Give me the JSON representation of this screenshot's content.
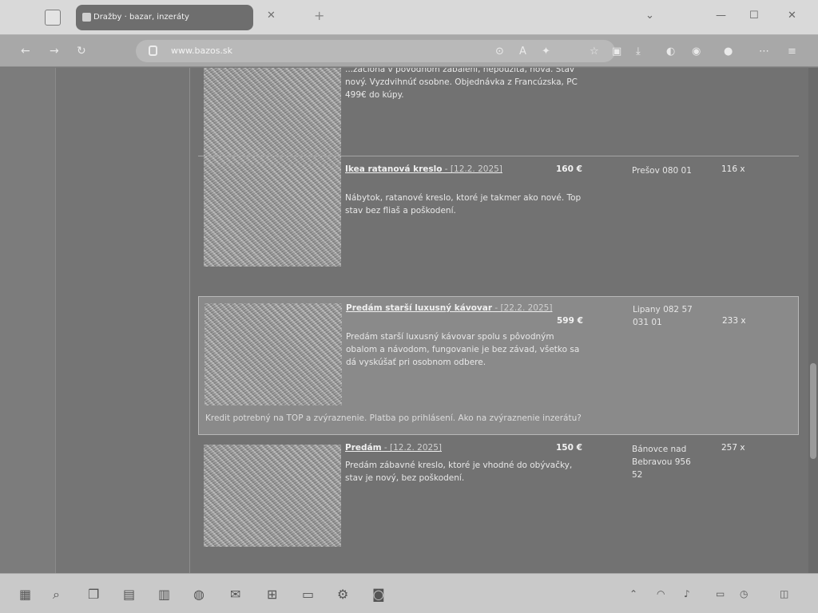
{
  "browser": {
    "tab_title": "Dražby · bazar, inzeráty",
    "close_tab": "✕",
    "new_tab": "+",
    "url": "www.bazos.sk",
    "window_controls": {
      "tabs_list": "⌄",
      "minimize": "—",
      "maximize": "☐",
      "close": "✕"
    }
  },
  "listings": [
    {
      "title": "",
      "date": "",
      "price": "",
      "location": "",
      "views": "",
      "description": "...záclona v pôvodnom zabalení, nepoužitá, nová. Stav nový. Vyzdvihnúť osobne. Objednávka z Francúzska, PC 499€ do kúpy.",
      "note": ""
    },
    {
      "title": "Ikea ratanová kreslo",
      "date": " - [12.2. 2025]",
      "price": "160 €",
      "location": "Prešov 080 01",
      "views": "116 x",
      "description": "Nábytok, ratanové kreslo, ktoré je takmer ako nové. Top stav bez fliaš a poškodení.",
      "note": ""
    },
    {
      "title": "Predám starší luxusný kávovar",
      "date": " - [22.2. 2025]",
      "price": "599 €",
      "location": "Lipany 082 57 031 01",
      "views": "233 x",
      "description": "Predám starší luxusný kávovar spolu s pôvodným obalom a návodom, fungovanie je bez závad, všetko sa dá vyskúšať pri osobnom odbere.",
      "note": "Kredit potrebný na TOP a zvýraznenie. Platba po prihlásení. Ako na zvýraznenie inzerátu?"
    },
    {
      "title": "Predám",
      "date": " - [12.2. 2025]",
      "price": "150 €",
      "location": "Bánovce nad Bebravou 956 52",
      "views": "257 x",
      "description": "Predám zábavné kreslo, ktoré je vhodné do obývačky, stav je nový, bez poškodení.",
      "note": ""
    }
  ]
}
